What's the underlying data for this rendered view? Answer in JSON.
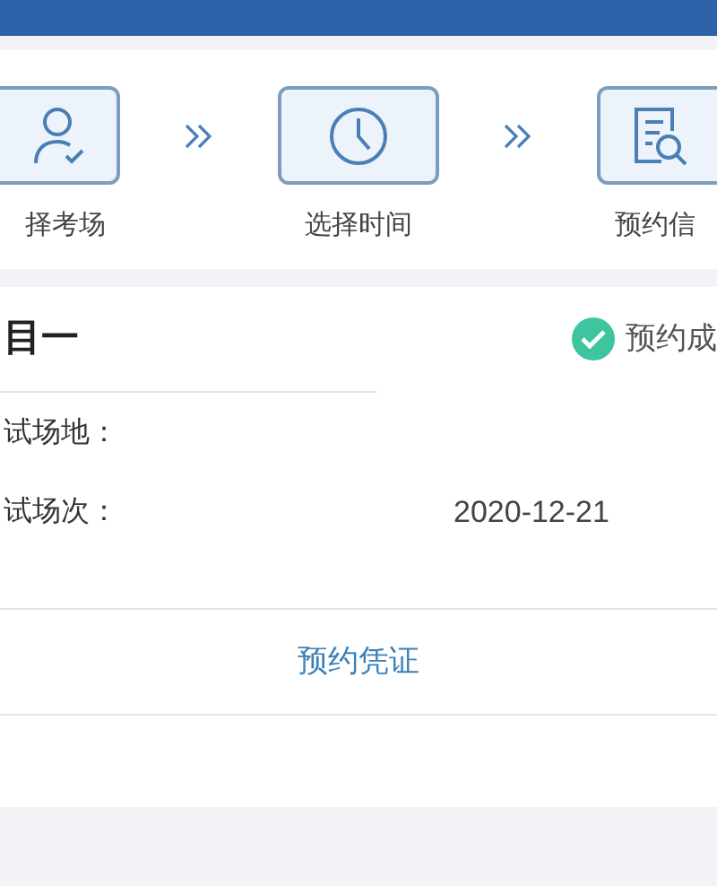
{
  "steps": [
    {
      "label": "择考场",
      "kind": "person"
    },
    {
      "label": "选择时间",
      "kind": "clock"
    },
    {
      "label": "预约信",
      "kind": "document"
    }
  ],
  "card": {
    "title": "目一",
    "status": {
      "label": "预约成",
      "done": true
    },
    "rows": [
      {
        "label": "试场地："
      },
      {
        "label": "试场次：",
        "value": "2020-12-21"
      }
    ],
    "button": "预约凭证"
  }
}
